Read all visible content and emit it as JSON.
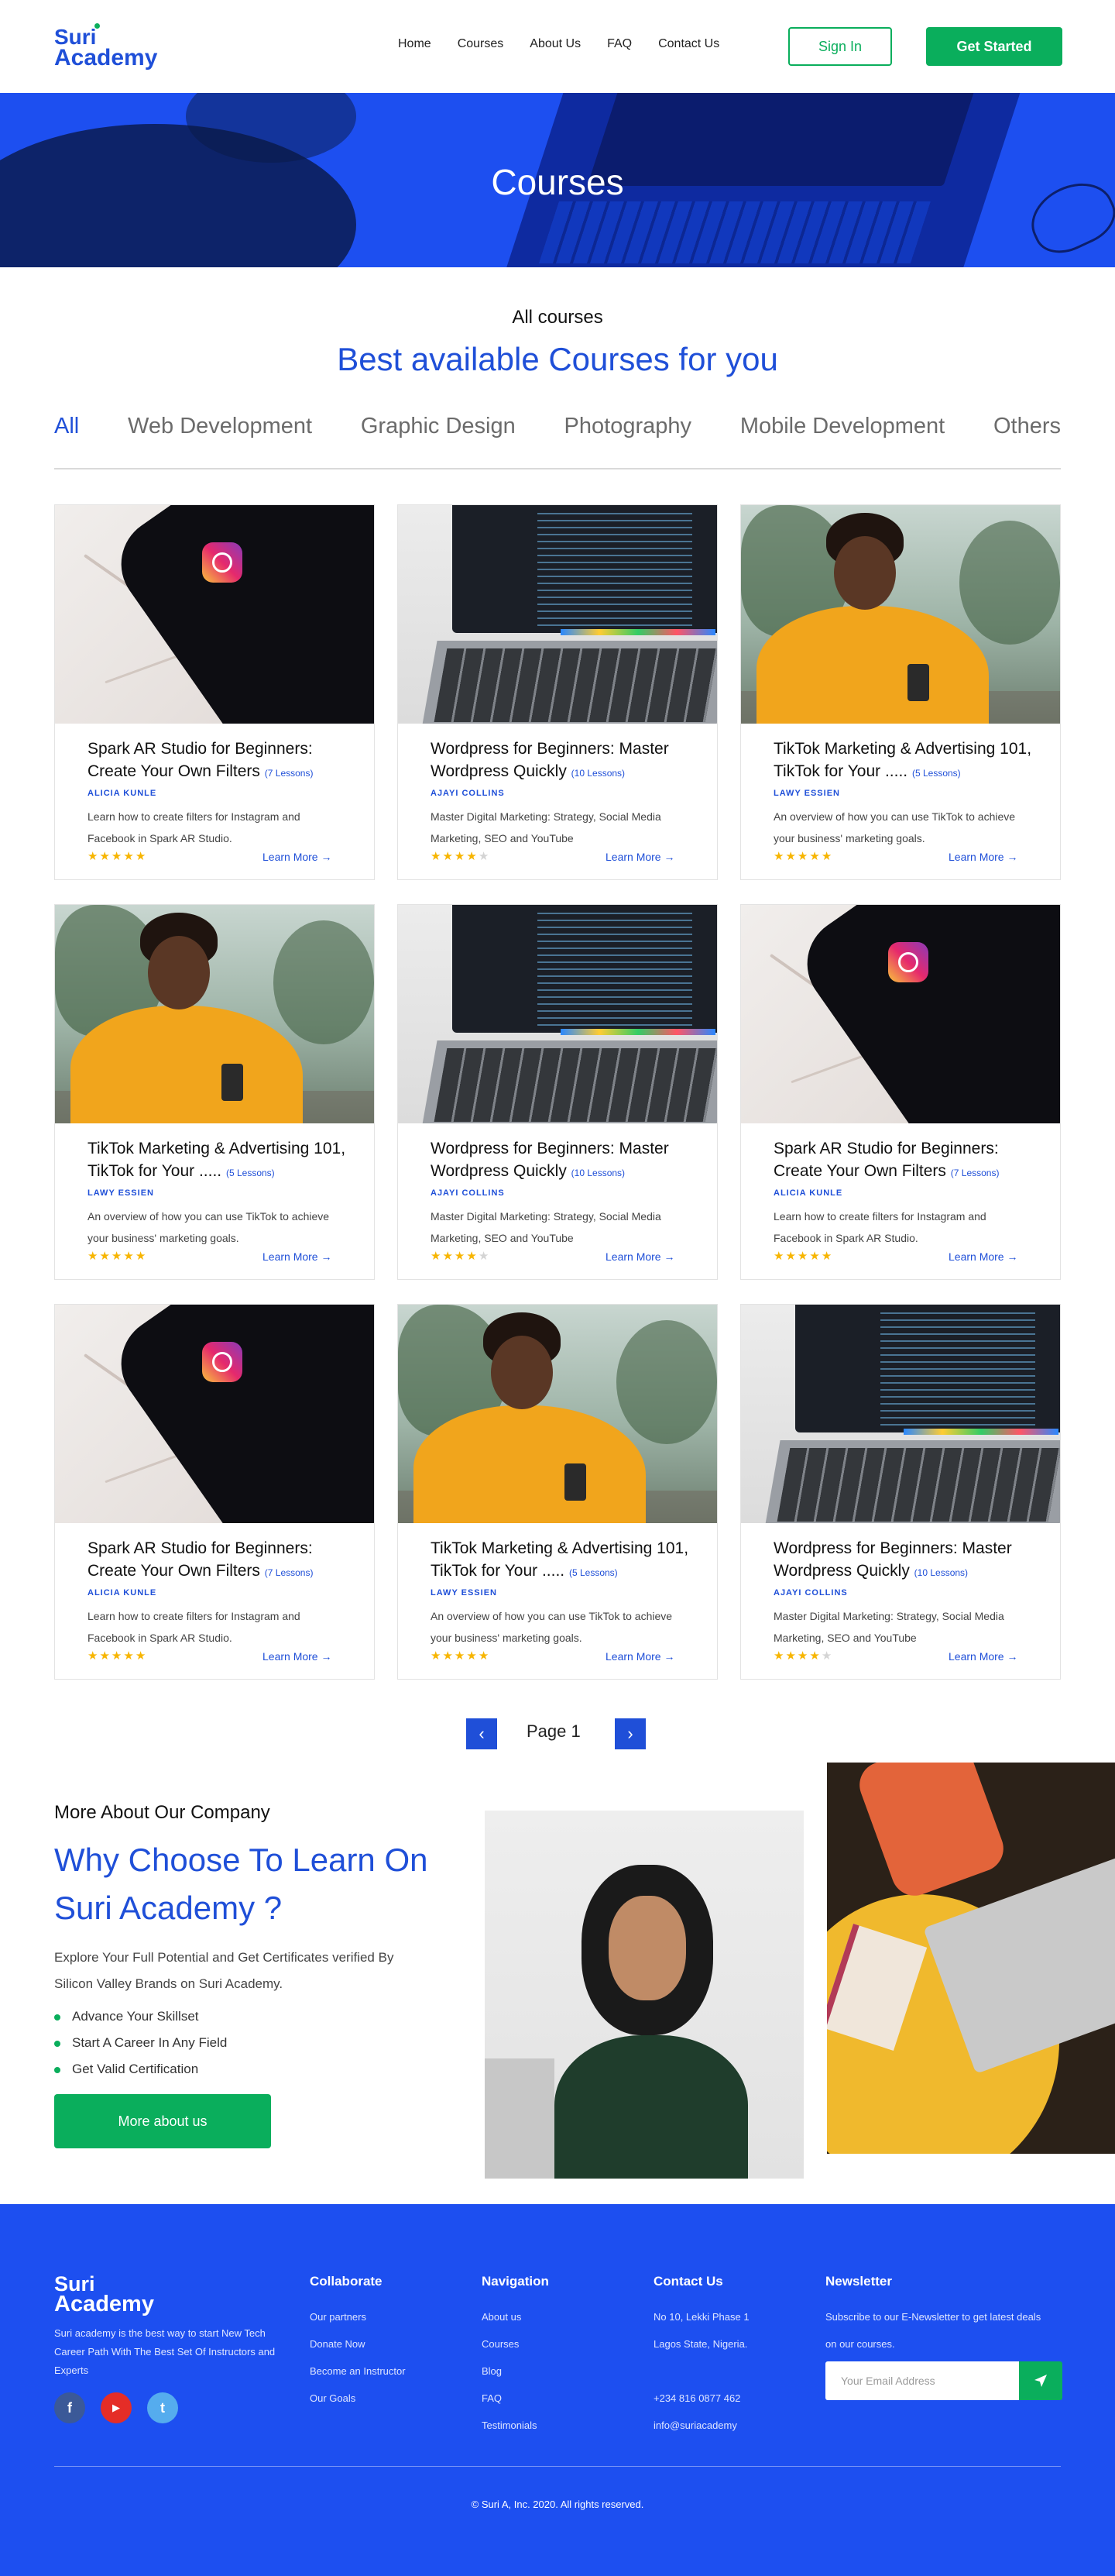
{
  "brand": {
    "line1": "Suri",
    "line2": "Academy",
    "primary_color": "#1f4fd8",
    "accent_color": "#0aae5c"
  },
  "nav": {
    "items": [
      "Home",
      "Courses",
      "About Us",
      "FAQ",
      "Contact Us"
    ],
    "sign_in": "Sign In",
    "get_started": "Get Started"
  },
  "hero": {
    "title": "Courses"
  },
  "courses_section": {
    "subtitle": "All courses",
    "title": "Best available Courses for you",
    "tabs": [
      "All",
      "Web Development",
      "Graphic Design",
      "Photography",
      "Mobile Development",
      "Others"
    ],
    "active_tab": "All"
  },
  "courses": [
    {
      "image": "instagram-phone",
      "title": "Spark AR Studio for Beginners: Create Your Own Filters",
      "lessons": "(7 Lessons)",
      "author": "ALICIA KUNLE",
      "desc": "Learn how to create filters for Instagram and Facebook in Spark AR Studio.",
      "rating": 5,
      "more": "Learn More →"
    },
    {
      "image": "laptop-code",
      "title": "Wordpress for Beginners: Master Wordpress Quickly",
      "lessons": "(10 Lessons)",
      "author": "AJAYI COLLINS",
      "desc": "Master Digital Marketing: Strategy, Social Media Marketing, SEO and YouTube",
      "rating": 4,
      "more": "Learn More →"
    },
    {
      "image": "woman-phone",
      "title": "TikTok Marketing & Advertising 101, TikTok for Your .....",
      "lessons": "(5 Lessons)",
      "author": "LAWY ESSIEN",
      "desc": "An overview of how you can use TikTok to achieve your business' marketing goals.",
      "rating": 5,
      "more": "Learn More →"
    },
    {
      "image": "woman-phone",
      "title": "TikTok Marketing & Advertising 101, TikTok for Your .....",
      "lessons": "(5 Lessons)",
      "author": "LAWY ESSIEN",
      "desc": "An overview of how you can use TikTok to achieve your business' marketing goals.",
      "rating": 5,
      "more": "Learn More →"
    },
    {
      "image": "laptop-code",
      "title": "Wordpress for Beginners: Master Wordpress Quickly",
      "lessons": "(10 Lessons)",
      "author": "AJAYI COLLINS",
      "desc": "Master Digital Marketing: Strategy, Social Media Marketing, SEO and YouTube",
      "rating": 4,
      "more": "Learn More →"
    },
    {
      "image": "instagram-phone",
      "title": "Spark AR Studio for Beginners: Create Your Own Filters",
      "lessons": "(7 Lessons)",
      "author": "ALICIA KUNLE",
      "desc": "Learn how to create filters for Instagram and Facebook in Spark AR Studio.",
      "rating": 5,
      "more": "Learn More →"
    },
    {
      "image": "instagram-phone",
      "title": "Spark AR Studio for Beginners: Create Your Own Filters",
      "lessons": "(7 Lessons)",
      "author": "ALICIA KUNLE",
      "desc": "Learn how to create filters for Instagram and Facebook in Spark AR Studio.",
      "rating": 5,
      "more": "Learn More →"
    },
    {
      "image": "woman-phone",
      "title": "TikTok Marketing & Advertising 101, TikTok for Your .....",
      "lessons": "(5 Lessons)",
      "author": "LAWY ESSIEN",
      "desc": "An overview of how you can use TikTok to achieve your business' marketing goals.",
      "rating": 5,
      "more": "Learn More →"
    },
    {
      "image": "laptop-code",
      "title": "Wordpress for Beginners: Master Wordpress Quickly",
      "lessons": "(10 Lessons)",
      "author": "AJAYI COLLINS",
      "desc": "Master Digital Marketing: Strategy, Social Media Marketing, SEO and YouTube",
      "rating": 4,
      "more": "Learn More →"
    }
  ],
  "pagination": {
    "label": "Page 1",
    "prev_icon": "chevron-left-icon",
    "next_icon": "chevron-right-icon"
  },
  "about": {
    "subtitle": "More About Our Company",
    "title": "Why Choose To Learn On Suri Academy ?",
    "desc": "Explore Your Full Potential and Get Certificates verified By Silicon Valley Brands on Suri Academy.",
    "points": [
      "Advance Your Skillset",
      "Start A Career In Any Field",
      "Get Valid Certification"
    ],
    "button": "More about us"
  },
  "footer": {
    "about": "Suri academy is the best way to start New Tech Career Path With The Best Set Of Instructors and Experts",
    "social": [
      {
        "icon": "facebook-icon",
        "glyph": "f",
        "color": "#3b5998"
      },
      {
        "icon": "youtube-icon",
        "glyph": "▶",
        "color": "#e52d27"
      },
      {
        "icon": "twitter-icon",
        "glyph": "t",
        "color": "#55acee"
      }
    ],
    "collaborate": {
      "title": "Collaborate",
      "links": [
        "Our partners",
        "Donate Now",
        "Become an Instructor",
        "Our Goals"
      ]
    },
    "navigation": {
      "title": "Navigation",
      "links": [
        "About us",
        "Courses",
        "Blog",
        "FAQ",
        "Testimonials"
      ]
    },
    "contact": {
      "title": "Contact Us",
      "address1": "No 10, Lekki Phase 1",
      "address2": "Lagos State, Nigeria.",
      "phone": "+234  816 0877 462",
      "email": "info@suriacademy"
    },
    "newsletter": {
      "title": "Newsletter",
      "text": "Subscribe  to our E-Newsletter to get latest deals on our courses.",
      "placeholder": "Your Email Address",
      "send_icon": "send-icon"
    },
    "copyright": "© Suri A, Inc. 2020. All rights reserved."
  }
}
